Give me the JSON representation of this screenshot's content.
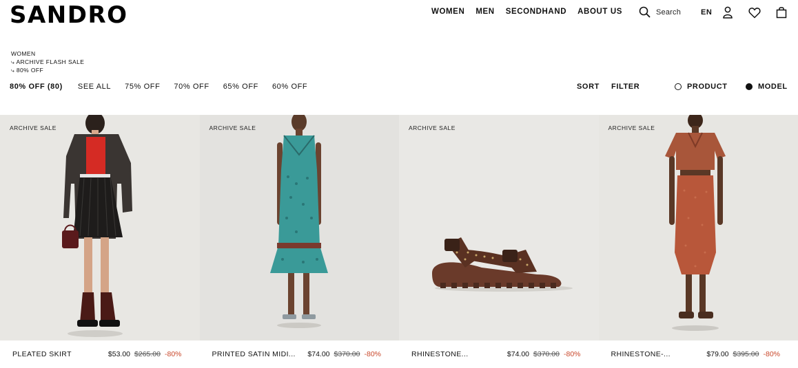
{
  "brand": "SANDRO",
  "nav": [
    "WOMEN",
    "MEN",
    "SECONDHAND",
    "ABOUT US"
  ],
  "search_label": "Search",
  "lang": "EN",
  "icons": {
    "search": "search-icon",
    "account": "user-icon",
    "wishlist": "heart-icon",
    "bag": "bag-icon"
  },
  "breadcrumb": [
    "WOMEN",
    "⤷ ARCHIVE FLASH SALE",
    "⤷ 80% OFF"
  ],
  "filters": {
    "active": "80% OFF (80)",
    "items": [
      "SEE ALL",
      "75% OFF",
      "70% OFF",
      "65% OFF",
      "60% OFF"
    ]
  },
  "sort_label": "SORT",
  "filter_label": "FILTER",
  "view": {
    "product": "PRODUCT",
    "model": "MODEL",
    "selected": "model"
  },
  "colors": {
    "discount": "#c9472a",
    "card_bg": "#e9e8e4"
  },
  "products": [
    {
      "badge": "ARCHIVE SALE",
      "name": "PLEATED SKIRT",
      "price": "$53.00",
      "old_price": "$265.00",
      "discount": "-80%"
    },
    {
      "badge": "ARCHIVE SALE",
      "name": "PRINTED SATIN MIDI...",
      "price": "$74.00",
      "old_price": "$370.00",
      "discount": "-80%"
    },
    {
      "badge": "ARCHIVE SALE",
      "name": "RHINESTONE...",
      "price": "$74.00",
      "old_price": "$370.00",
      "discount": "-80%"
    },
    {
      "badge": "ARCHIVE SALE",
      "name": "RHINESTONE-...",
      "price": "$79.00",
      "old_price": "$395.00",
      "discount": "-80%"
    }
  ]
}
